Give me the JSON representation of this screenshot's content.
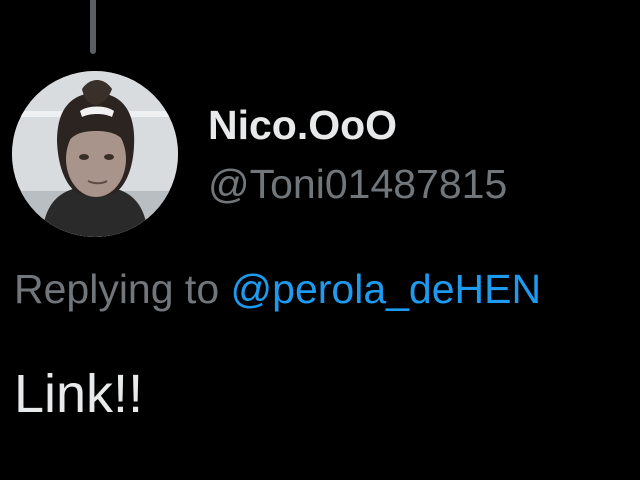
{
  "tweet": {
    "author": {
      "display_name": "Nico.OoO",
      "handle": "@Toni01487815",
      "avatar_icon": "profile-photo"
    },
    "replying_to": {
      "prefix": "Replying to",
      "mention": "@perola_deHEN"
    },
    "text": "Link!!"
  },
  "colors": {
    "background": "#000000",
    "primary_text": "#e7e9ea",
    "secondary_text": "#71767b",
    "link": "#1d9bf0",
    "thread_line": "#5b6064"
  }
}
